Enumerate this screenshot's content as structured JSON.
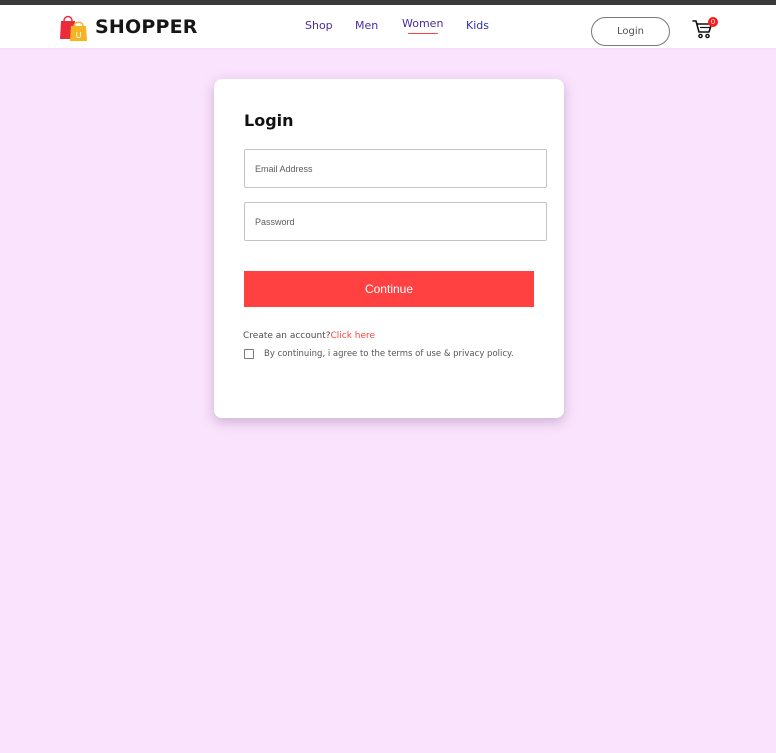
{
  "brand": {
    "name": "SHOPPER",
    "logo_icon": "shopping-bag-icon",
    "logo_letter": "U"
  },
  "nav": {
    "items": [
      {
        "label": "Shop",
        "active": false
      },
      {
        "label": "Men",
        "active": false
      },
      {
        "label": "Women",
        "active": true
      },
      {
        "label": "Kids",
        "active": false
      }
    ]
  },
  "header": {
    "login_label": "Login",
    "cart_icon": "cart-icon",
    "cart_count": "0"
  },
  "login_form": {
    "title": "Login",
    "email_placeholder": "Email Address",
    "password_placeholder": "Password",
    "continue_label": "Continue",
    "signup_prompt": "Create an account?",
    "signup_link": "Click here",
    "agree_text": "By continuing, i agree to the terms of use & privacy policy."
  },
  "colors": {
    "accent": "#ff4141",
    "page_background": "#fae3fd",
    "nav_text": "#4a2b9e",
    "top_bar": "#3a3a3a"
  }
}
